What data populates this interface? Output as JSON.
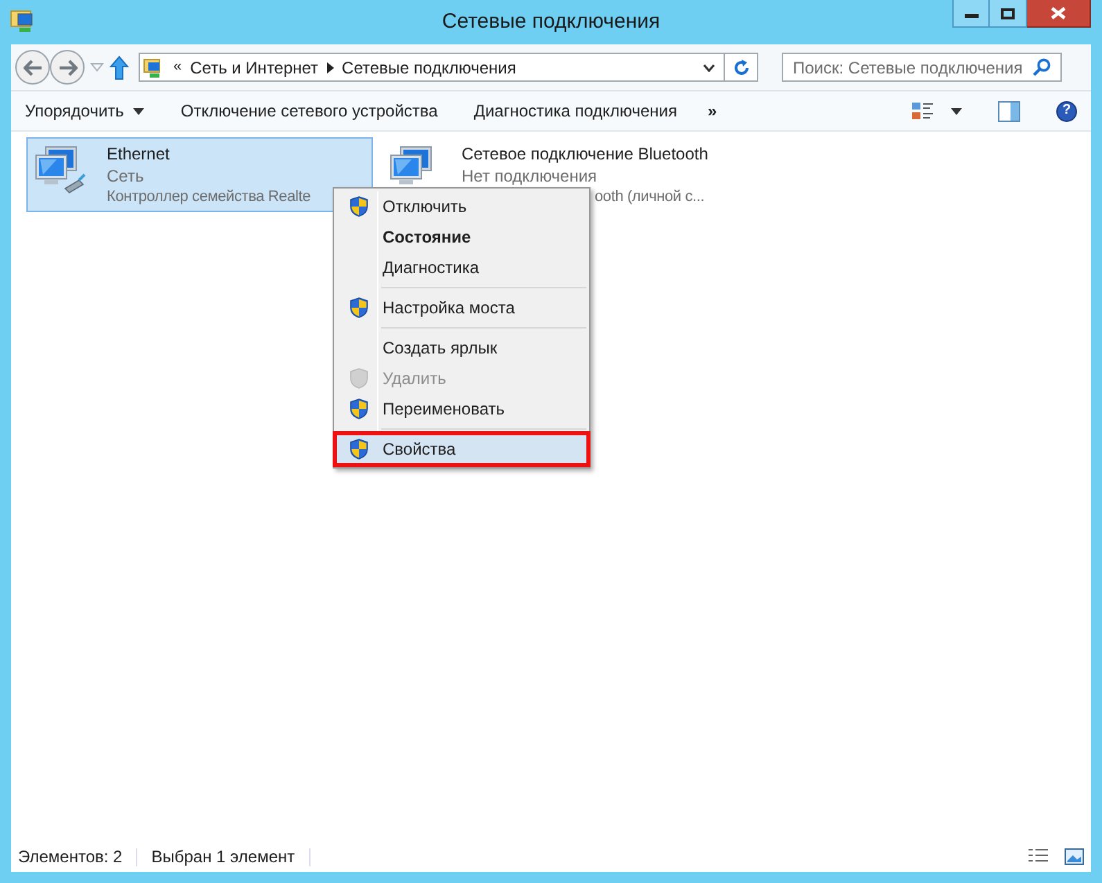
{
  "window": {
    "title": "Сетевые подключения"
  },
  "address": {
    "overflow": "«",
    "crumbs": [
      "Сеть и Интернет",
      "Сетевые подключения"
    ]
  },
  "search": {
    "placeholder": "Поиск: Сетевые подключения"
  },
  "toolbar": {
    "items": [
      {
        "label": "Упорядочить",
        "dropdown": true
      },
      {
        "label": "Отключение сетевого устройства",
        "dropdown": false
      },
      {
        "label": "Диагностика подключения",
        "dropdown": false
      }
    ],
    "more": "»",
    "help": "?"
  },
  "connections": [
    {
      "name": "Ethernet",
      "status": "Сеть",
      "device": "Контроллер семейства Realte",
      "selected": true
    },
    {
      "name": "Сетевое подключение Bluetooth",
      "status": "Нет подключения",
      "device": "ooth (личной с...",
      "selected": false
    }
  ],
  "context_menu": [
    {
      "kind": "item",
      "label": "Отключить",
      "shield": true,
      "bold": false,
      "disabled": false,
      "selected": false
    },
    {
      "kind": "item",
      "label": "Состояние",
      "shield": false,
      "bold": true,
      "disabled": false,
      "selected": false
    },
    {
      "kind": "item",
      "label": "Диагностика",
      "shield": false,
      "bold": false,
      "disabled": false,
      "selected": false
    },
    {
      "kind": "separator"
    },
    {
      "kind": "item",
      "label": "Настройка моста",
      "shield": true,
      "bold": false,
      "disabled": false,
      "selected": false
    },
    {
      "kind": "separator"
    },
    {
      "kind": "item",
      "label": "Создать ярлык",
      "shield": false,
      "bold": false,
      "disabled": false,
      "selected": false
    },
    {
      "kind": "item",
      "label": "Удалить",
      "shield": true,
      "bold": false,
      "disabled": true,
      "selected": false
    },
    {
      "kind": "item",
      "label": "Переименовать",
      "shield": true,
      "bold": false,
      "disabled": false,
      "selected": false
    },
    {
      "kind": "separator"
    },
    {
      "kind": "item",
      "label": "Свойства",
      "shield": true,
      "bold": false,
      "disabled": false,
      "selected": true
    }
  ],
  "status_bar": {
    "count": "Элементов: 2",
    "selection": "Выбран 1 элемент"
  }
}
